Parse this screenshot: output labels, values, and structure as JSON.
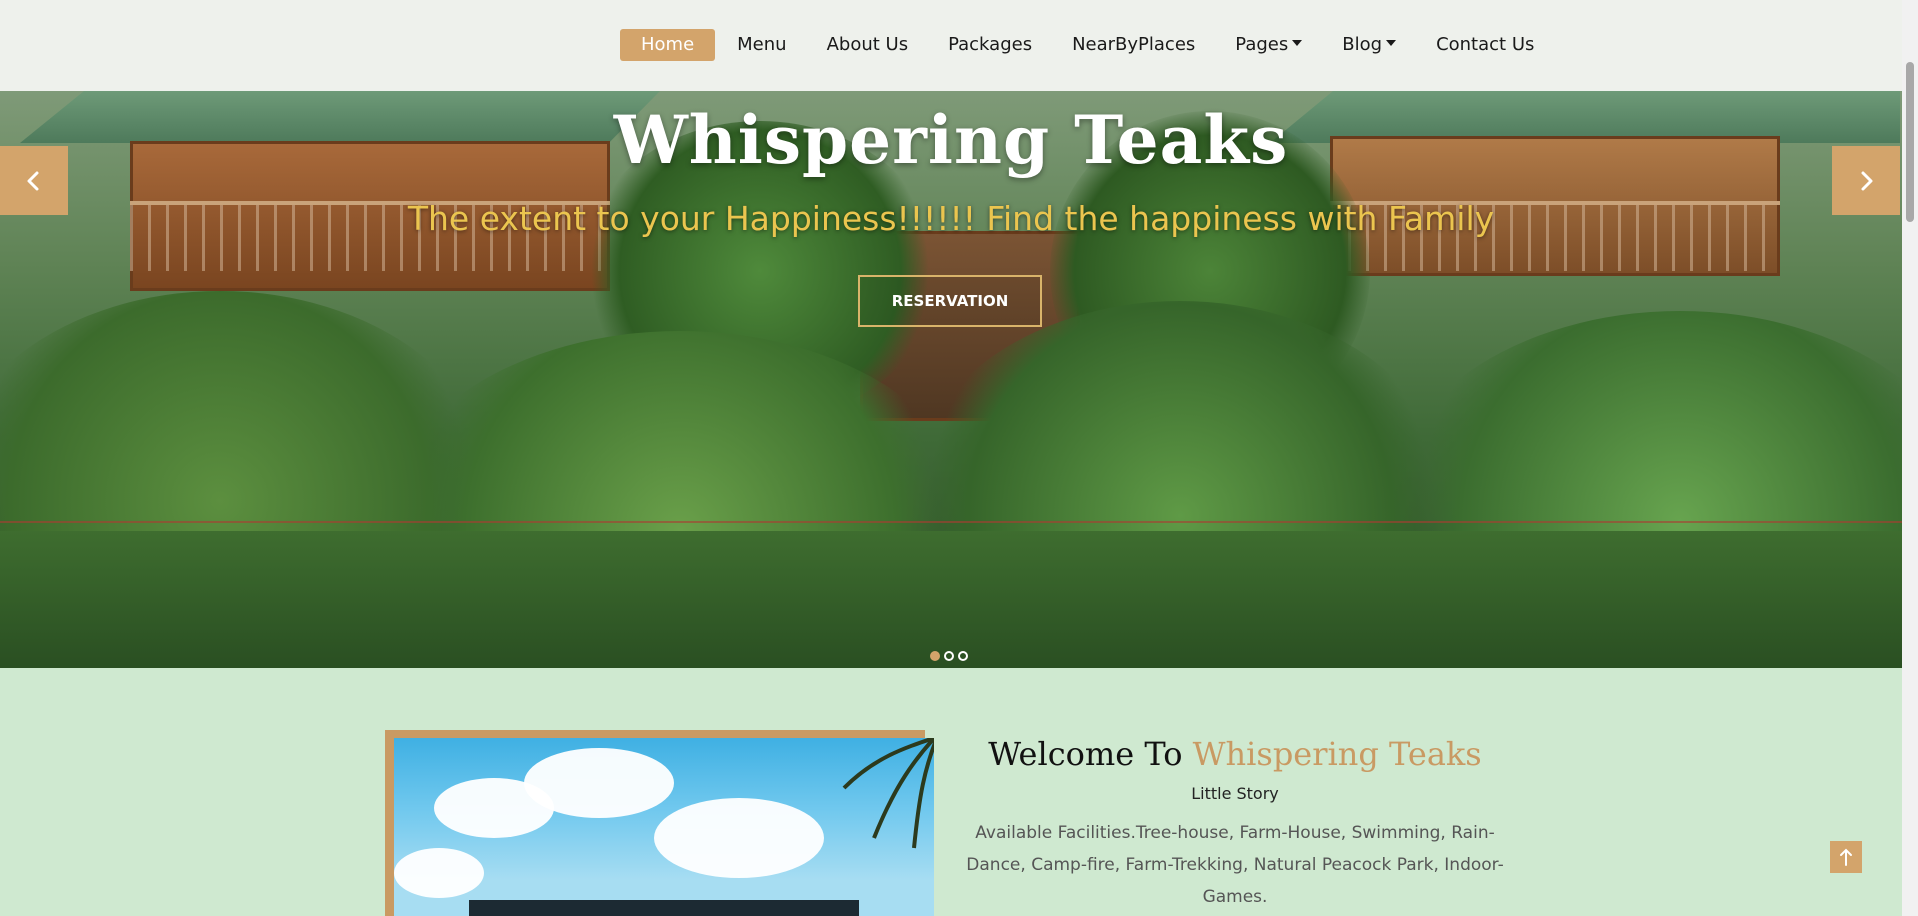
{
  "nav": {
    "items": [
      {
        "label": "Home",
        "active": true
      },
      {
        "label": "Menu"
      },
      {
        "label": "About Us"
      },
      {
        "label": "Packages"
      },
      {
        "label": "NearByPlaces"
      },
      {
        "label": "Pages",
        "dropdown": true
      },
      {
        "label": "Blog",
        "dropdown": true
      },
      {
        "label": "Contact Us"
      }
    ]
  },
  "hero": {
    "title": "Whispering Teaks",
    "subtitle": "The extent to your Happiness!!!!!! Find the happiness with Family",
    "button_label": "RESERVATION",
    "slide_count": 3,
    "active_slide": 1,
    "prev_icon": "chevron-left-icon",
    "next_icon": "chevron-right-icon"
  },
  "welcome": {
    "title_prefix": "Welcome To",
    "title_accent": "Whispering Teaks",
    "story_label": "Little Story",
    "description": "Available Facilities.Tree-house, Farm-House, Swimming, Rain-Dance, Camp-fire, Farm-Trekking, Natural Peacock Park, Indoor-Games."
  },
  "colors": {
    "accent": "#d3a46b",
    "page_bg": "#cfe9d0",
    "nav_bg": "#eef1ec",
    "subtitle": "#ebc54f"
  },
  "scroll_top_icon": "arrow-up-icon"
}
